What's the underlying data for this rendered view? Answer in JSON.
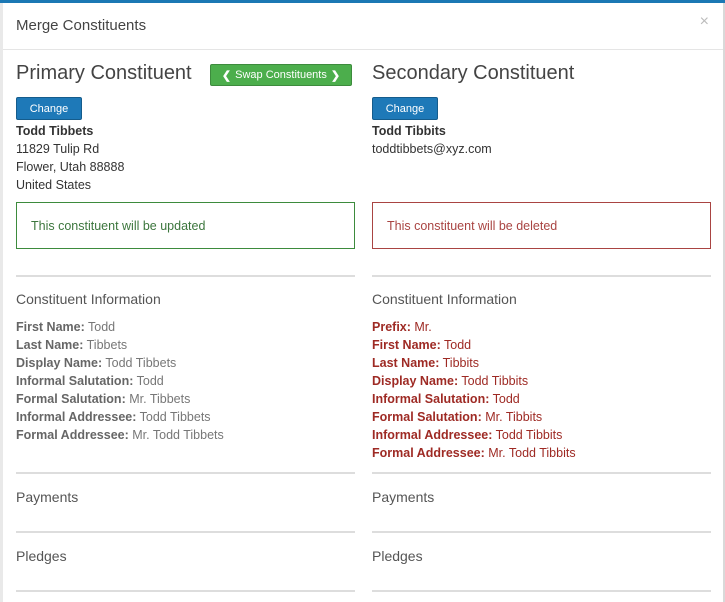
{
  "modal": {
    "title": "Merge Constituents",
    "close_glyph": "×"
  },
  "swap": {
    "label": "Swap Constituents",
    "left_chevron": "❮",
    "right_chevron": "❯"
  },
  "primary": {
    "heading": "Primary Constituent",
    "change_label": "Change",
    "name": "Todd Tibbets",
    "lines": [
      "11829 Tulip Rd",
      "Flower, Utah 88888",
      "United States"
    ],
    "alert": "This constituent will be updated",
    "section_info": "Constituent Information",
    "fields": [
      {
        "label": "First Name:",
        "value": "Todd"
      },
      {
        "label": "Last Name:",
        "value": "Tibbets"
      },
      {
        "label": "Display Name:",
        "value": "Todd Tibbets"
      },
      {
        "label": "Informal Salutation:",
        "value": "Todd"
      },
      {
        "label": "Formal Salutation:",
        "value": "Mr. Tibbets"
      },
      {
        "label": "Informal Addressee:",
        "value": "Todd Tibbets"
      },
      {
        "label": "Formal Addressee:",
        "value": "Mr. Todd Tibbets"
      }
    ],
    "section_payments": "Payments",
    "section_pledges": "Pledges"
  },
  "secondary": {
    "heading": "Secondary Constituent",
    "change_label": "Change",
    "name": "Todd Tibbits",
    "lines": [
      "toddtibbets@xyz.com"
    ],
    "alert": "This constituent will be deleted",
    "section_info": "Constituent Information",
    "fields": [
      {
        "label": "Prefix:",
        "value": "Mr."
      },
      {
        "label": "First Name:",
        "value": "Todd"
      },
      {
        "label": "Last Name:",
        "value": "Tibbits"
      },
      {
        "label": "Display Name:",
        "value": "Todd Tibbits"
      },
      {
        "label": "Informal Salutation:",
        "value": "Todd"
      },
      {
        "label": "Formal Salutation:",
        "value": "Mr. Tibbits"
      },
      {
        "label": "Informal Addressee:",
        "value": "Todd Tibbits"
      },
      {
        "label": "Formal Addressee:",
        "value": "Mr. Todd Tibbits"
      }
    ],
    "section_payments": "Payments",
    "section_pledges": "Pledges"
  },
  "colors": {
    "accent_blue": "#1e79b8",
    "success_green": "#4cae4c",
    "danger_red": "#a94442",
    "field_red": "#9e2a24"
  }
}
